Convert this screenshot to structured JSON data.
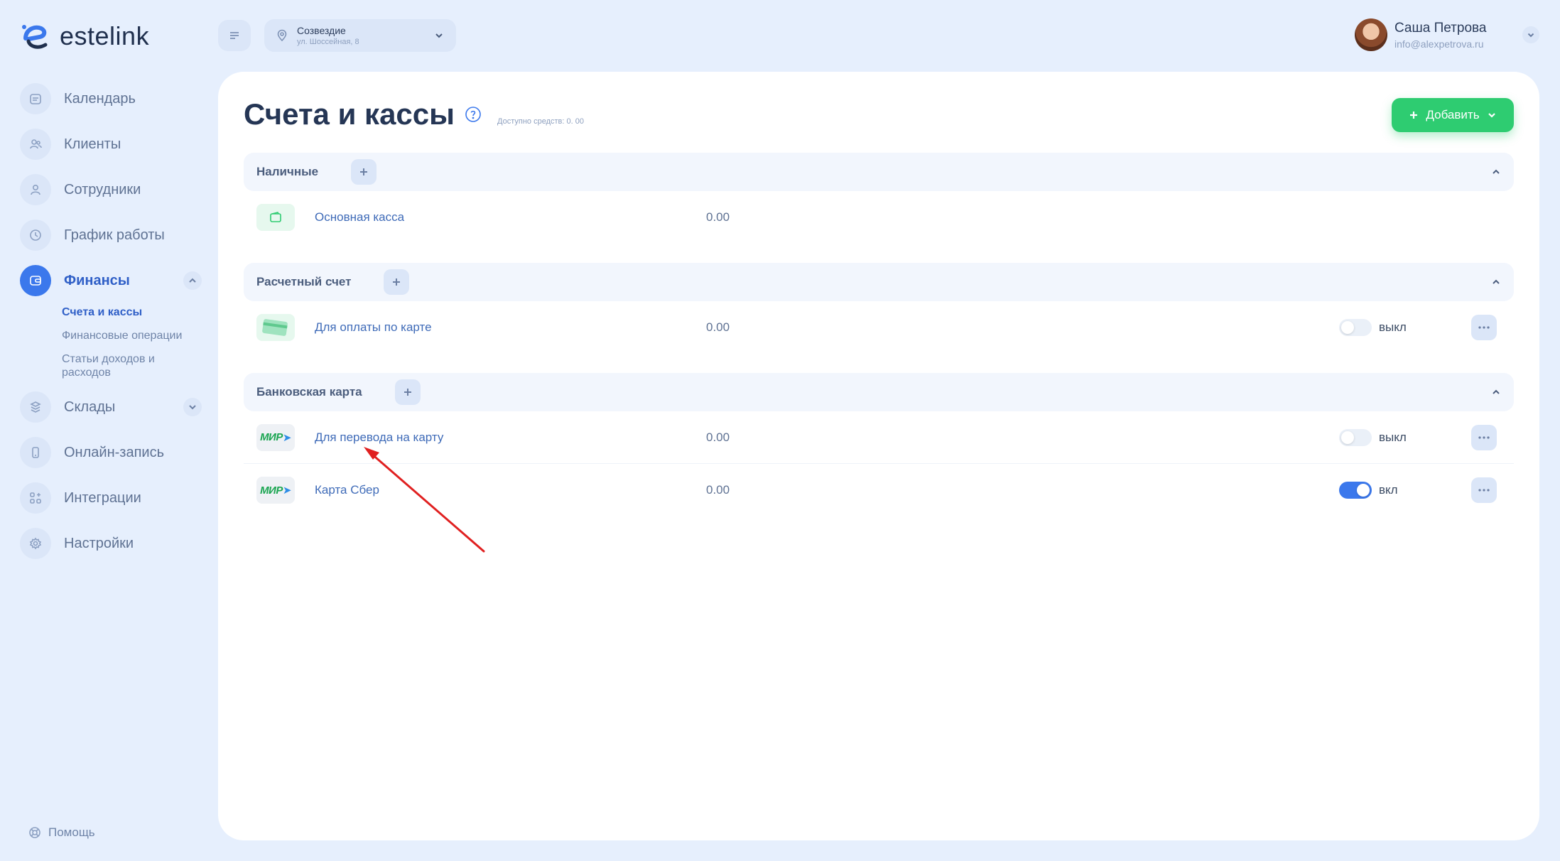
{
  "brand": {
    "name": "estelink"
  },
  "sidebar": {
    "items": [
      {
        "id": "calendar",
        "label": "Календарь",
        "icon": "calendar-icon"
      },
      {
        "id": "clients",
        "label": "Клиенты",
        "icon": "users-icon"
      },
      {
        "id": "staff",
        "label": "Сотрудники",
        "icon": "user-icon"
      },
      {
        "id": "schedule",
        "label": "График работы",
        "icon": "clock-icon"
      },
      {
        "id": "finance",
        "label": "Финансы",
        "icon": "wallet-icon",
        "active": true,
        "expanded": true
      },
      {
        "id": "warehouses",
        "label": "Склады",
        "icon": "layers-icon"
      },
      {
        "id": "online",
        "label": "Онлайн-запись",
        "icon": "phone-icon"
      },
      {
        "id": "integrations",
        "label": "Интеграции",
        "icon": "grid-plus-icon"
      },
      {
        "id": "settings",
        "label": "Настройки",
        "icon": "gear-icon"
      }
    ],
    "finance_sub": [
      {
        "label": "Счета и кассы",
        "active": true
      },
      {
        "label": "Финансовые операции"
      },
      {
        "label": "Статьи доходов и расходов"
      }
    ],
    "help_label": "Помощь"
  },
  "topbar": {
    "location_name": "Созвездие",
    "location_address": "ул. Шоссейная, 8"
  },
  "user": {
    "name": "Саша Петрова",
    "email": "info@alexpetrova.ru"
  },
  "page": {
    "title": "Счета и кассы",
    "available": "Доступно средств: 0. 00",
    "add_button": "Добавить"
  },
  "sections": [
    {
      "title": "Наличные",
      "rows": [
        {
          "name": "Основная касса",
          "amount": "0.00",
          "icon": "wallet-icon"
        }
      ]
    },
    {
      "title": "Расчетный счет",
      "rows": [
        {
          "name": "Для оплаты по карте",
          "amount": "0.00",
          "icon": "credit-card-icon",
          "toggle_label": "выкл",
          "enabled": false
        }
      ]
    },
    {
      "title": "Банковская карта",
      "rows": [
        {
          "name": "Для перевода на карту",
          "amount": "0.00",
          "icon": "mir-logo",
          "toggle_label": "выкл",
          "enabled": false
        },
        {
          "name": "Карта Сбер",
          "amount": "0.00",
          "icon": "mir-logo",
          "toggle_label": "вкл",
          "enabled": true
        }
      ]
    }
  ],
  "mir_logo_text": "МИР",
  "colors": {
    "accent": "#3b78ec",
    "success": "#2ecc71",
    "annotation_arrow": "#e02020"
  }
}
